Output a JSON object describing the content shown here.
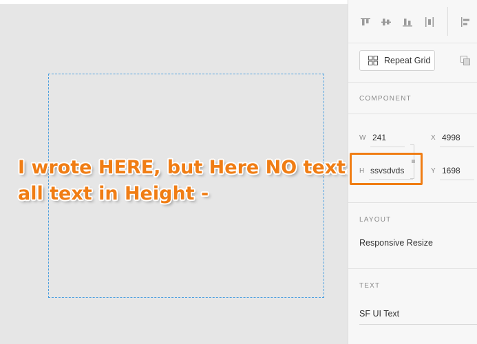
{
  "annotation": {
    "line1": "I wrote HERE, but Here NO text.",
    "line2": "all text in Height -"
  },
  "panel": {
    "toolbar": {
      "icons": [
        "align-top-icon",
        "align-middle-icon",
        "align-bottom-icon",
        "distribute-vertical-icon",
        "align-left-icon"
      ]
    },
    "repeat_grid": {
      "label": "Repeat Grid"
    },
    "component": {
      "title": "COMPONENT",
      "w_label": "W",
      "w_value": "241",
      "x_label": "X",
      "x_value": "4998",
      "h_label": "H",
      "h_value": "ssvsdvds",
      "y_label": "Y",
      "y_value": "1698"
    },
    "layout": {
      "title": "LAYOUT",
      "responsive_resize": "Responsive Resize"
    },
    "text": {
      "title": "TEXT",
      "font_family": "SF UI Text"
    }
  },
  "colors": {
    "annotation": "#f07d14",
    "selection_border": "#4b9fe0",
    "canvas_bg": "#e6e6e6",
    "panel_bg": "#f7f7f7"
  }
}
